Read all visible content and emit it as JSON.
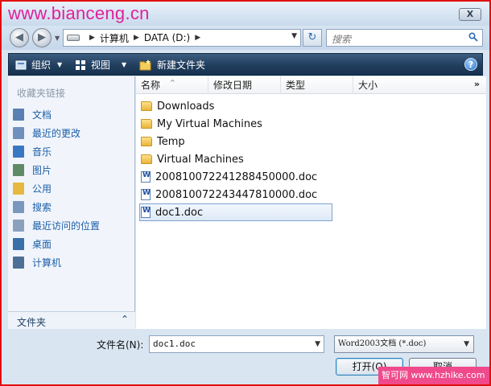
{
  "watermark": "www.bianceng.cn",
  "title_bar": {
    "close_label": "X"
  },
  "address": {
    "crumbs": [
      "计算机",
      "DATA (D:)"
    ],
    "search_placeholder": "搜索"
  },
  "toolbar": {
    "organize_label": "组织",
    "views_label": "视图",
    "new_folder_label": "新建文件夹",
    "help_label": "?"
  },
  "sidebar": {
    "favorites_title": "收藏夹链接",
    "items": [
      {
        "label": "文档",
        "icon": "documents-icon",
        "color": "#5a7fb2"
      },
      {
        "label": "最近的更改",
        "icon": "recent-changes-icon",
        "color": "#6f8fbf"
      },
      {
        "label": "音乐",
        "icon": "music-icon",
        "color": "#3b78c4"
      },
      {
        "label": "图片",
        "icon": "pictures-icon",
        "color": "#5f8a66"
      },
      {
        "label": "公用",
        "icon": "public-icon",
        "color": "#e6b840"
      },
      {
        "label": "搜索",
        "icon": "search-folder-icon",
        "color": "#7a97bd"
      },
      {
        "label": "最近访问的位置",
        "icon": "recent-places-icon",
        "color": "#8aa0bd"
      },
      {
        "label": "桌面",
        "icon": "desktop-icon",
        "color": "#3a6ea8"
      },
      {
        "label": "计算机",
        "icon": "computer-icon",
        "color": "#4e6f95"
      }
    ],
    "folders_toggle_label": "文件夹",
    "folders_toggle_icon": "chevron-up-icon"
  },
  "columns": {
    "name": "名称",
    "date_modified": "修改日期",
    "type": "类型",
    "size": "大小",
    "more": "»"
  },
  "files": [
    {
      "name": "Downloads",
      "kind": "folder"
    },
    {
      "name": "My Virtual Machines",
      "kind": "folder"
    },
    {
      "name": "Temp",
      "kind": "folder"
    },
    {
      "name": "Virtual Machines",
      "kind": "folder"
    },
    {
      "name": "20081007224128845000​0.doc",
      "kind": "doc"
    },
    {
      "name": "20081007224344781000​0.doc",
      "kind": "doc"
    },
    {
      "name": "doc1.doc",
      "kind": "doc",
      "selected": true
    }
  ],
  "bottom": {
    "filename_label": "文件名(N):",
    "filename_value": "doc1.doc",
    "filetype_value": "Word2003文档 (*.doc)",
    "open_label": "打开(O)",
    "cancel_label": "取消"
  },
  "corner_watermark": "智可网 www.hzhike.com",
  "colors": {
    "toolbar": "#213e5e",
    "link": "#1b5ea8",
    "border": "#e01010"
  }
}
